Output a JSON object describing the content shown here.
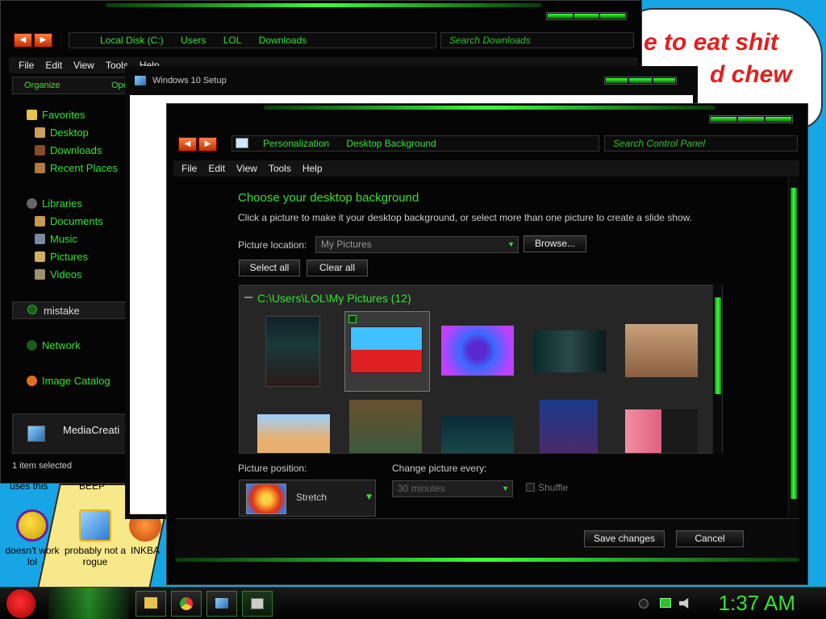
{
  "desktop": {
    "wallpaper_line1": "e to eat shit",
    "wallpaper_line2": "d chew",
    "label_uses_this": "uses this",
    "label_beep": "BEEP",
    "icons": [
      {
        "label": "doesn't work lol"
      },
      {
        "label": "probably not a rogue"
      },
      {
        "label": "INKBA"
      }
    ]
  },
  "explorer": {
    "address": [
      "Local Disk (C:)",
      "Users",
      "LOL",
      "Downloads"
    ],
    "search_placeholder": "Search Downloads",
    "menu": [
      "File",
      "Edit",
      "View",
      "Tools",
      "Help"
    ],
    "organize": "Organize",
    "open": "Ope",
    "favorites": "Favorites",
    "fav_items": [
      "Desktop",
      "Downloads",
      "Recent Places"
    ],
    "libraries": "Libraries",
    "lib_items": [
      "Documents",
      "Music",
      "Pictures",
      "Videos"
    ],
    "homegroup": "mistake",
    "network": "Network",
    "image_catalog": "Image Catalog",
    "selected_file": "MediaCreati",
    "status": "1 item selected"
  },
  "setup": {
    "title": "Windows 10 Setup"
  },
  "control_panel": {
    "address": [
      "Personalization",
      "Desktop Background"
    ],
    "search_placeholder": "Search Control Panel",
    "menu": [
      "File",
      "Edit",
      "View",
      "Tools",
      "Help"
    ],
    "heading": "Choose your desktop background",
    "description": "Click a picture to make it your desktop background, or select more than one picture to create a slide show.",
    "picture_location_label": "Picture location:",
    "picture_location_value": "My Pictures",
    "browse_button": "Browse...",
    "select_all_button": "Select all",
    "clear_all_button": "Clear all",
    "folder_header": "C:\\Users\\LOL\\My Pictures (12)",
    "picture_position_label": "Picture position:",
    "picture_position_value": "Stretch",
    "change_every_label": "Change picture every:",
    "change_every_value": "30 minutes",
    "shuffle_label": "Shuffle",
    "save_button": "Save changes",
    "cancel_button": "Cancel"
  },
  "taskbar": {
    "clock": "1:37 AM"
  }
}
